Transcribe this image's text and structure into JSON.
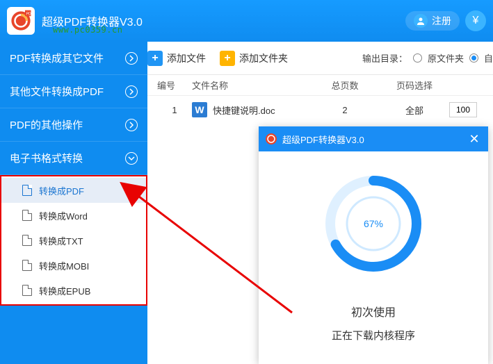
{
  "titlebar": {
    "app_title": "超级PDF转换器V3.0",
    "register_label": "注册",
    "yen_symbol": "¥",
    "url_watermark": "www.pc0359.cn"
  },
  "toolbar": {
    "add_file_label": "添加文件",
    "add_folder_label": "添加文件夹",
    "output_dir_label": "输出目录：",
    "radio_original_label": "原文件夹",
    "radio_custom_label": "自",
    "radio_selected": "custom"
  },
  "sidebar": {
    "categories": [
      {
        "label": "PDF转换成其它文件",
        "expanded": false
      },
      {
        "label": "其他文件转换成PDF",
        "expanded": false
      },
      {
        "label": "PDF的其他操作",
        "expanded": false
      },
      {
        "label": "电子书格式转换",
        "expanded": true
      }
    ],
    "sub_items": [
      {
        "label": "转换成PDF",
        "selected": true
      },
      {
        "label": "转换成Word",
        "selected": false
      },
      {
        "label": "转换成TXT",
        "selected": false
      },
      {
        "label": "转换成MOBI",
        "selected": false
      },
      {
        "label": "转换成EPUB",
        "selected": false
      }
    ]
  },
  "table": {
    "headers": {
      "num": "编号",
      "name": "文件名称",
      "pages": "总页数",
      "range": "页码选择",
      "pct": ""
    },
    "rows": [
      {
        "num": "1",
        "icon": "W",
        "name": "快捷键说明.doc",
        "pages": "2",
        "range": "全部",
        "pct": "100"
      }
    ]
  },
  "dialog": {
    "title": "超级PDF转换器V3.0",
    "percent": "67%",
    "line1": "初次使用",
    "line2": "正在下载内核程序",
    "progress_value": 67
  },
  "colors": {
    "primary": "#1a8df5",
    "accent_orange": "#ffb400",
    "annotation_red": "#e80202"
  }
}
